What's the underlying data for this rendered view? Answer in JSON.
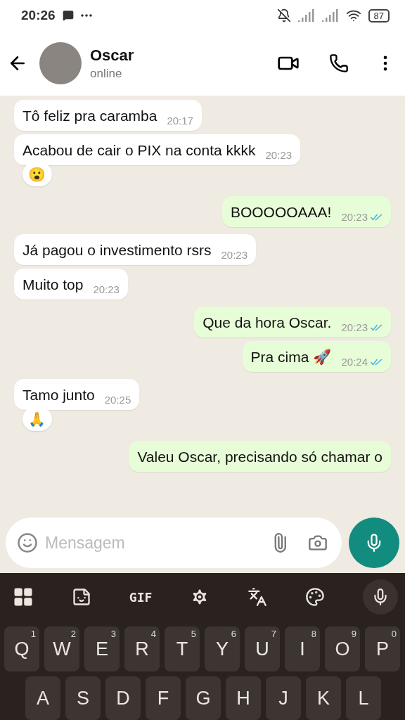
{
  "status_bar": {
    "time": "20:26",
    "battery": "87"
  },
  "header": {
    "name": "Oscar",
    "status": "online"
  },
  "messages": [
    {
      "kind": "in",
      "text": "Tô feliz pra caramba",
      "time": "20:17"
    },
    {
      "kind": "in",
      "text": "Acabou de cair o PIX na conta kkkk",
      "time": "20:23",
      "reaction": "😮"
    },
    {
      "kind": "out",
      "text": "BOOOOOAAA!",
      "time": "20:23",
      "read": true
    },
    {
      "kind": "in",
      "text": "Já pagou o investimento rsrs",
      "time": "20:23"
    },
    {
      "kind": "in",
      "text": "Muito top",
      "time": "20:23"
    },
    {
      "kind": "out",
      "text": "Que da hora  Oscar.",
      "time": "20:23",
      "read": true
    },
    {
      "kind": "out",
      "text": "Pra cima 🚀",
      "time": "20:24",
      "read": true
    },
    {
      "kind": "in",
      "text": "Tamo junto",
      "time": "20:25",
      "reaction": "🙏"
    },
    {
      "kind": "out",
      "text": "Valeu Oscar, precisando só  chamar o"
    }
  ],
  "composer": {
    "placeholder": "Mensagem"
  },
  "keyboard": {
    "gif_label": "GIF",
    "rows": [
      [
        {
          "letter": "Q",
          "hint": "1"
        },
        {
          "letter": "W",
          "hint": "2"
        },
        {
          "letter": "E",
          "hint": "3"
        },
        {
          "letter": "R",
          "hint": "4"
        },
        {
          "letter": "T",
          "hint": "5"
        },
        {
          "letter": "Y",
          "hint": "6"
        },
        {
          "letter": "U",
          "hint": "7"
        },
        {
          "letter": "I",
          "hint": "8"
        },
        {
          "letter": "O",
          "hint": "9"
        },
        {
          "letter": "P",
          "hint": "0"
        }
      ],
      [
        {
          "letter": "A"
        },
        {
          "letter": "S"
        },
        {
          "letter": "D"
        },
        {
          "letter": "F"
        },
        {
          "letter": "G"
        },
        {
          "letter": "H"
        },
        {
          "letter": "J"
        },
        {
          "letter": "K"
        },
        {
          "letter": "L"
        }
      ]
    ]
  }
}
